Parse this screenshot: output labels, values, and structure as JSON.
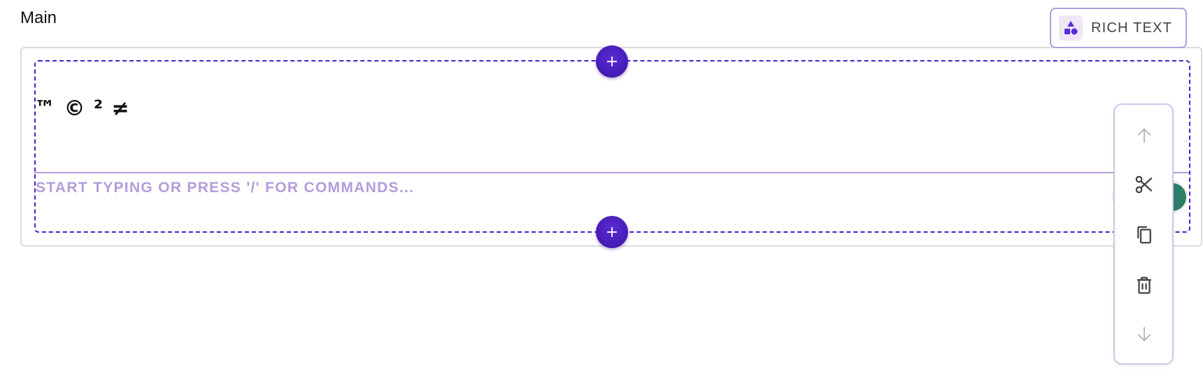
{
  "section": {
    "title": "Main"
  },
  "block_type": {
    "label": "RICH TEXT",
    "icon": "shapes-icon"
  },
  "editor": {
    "content": "™ © ² ≠",
    "placeholder": "START TYPING OR PRESS '/' FOR COMMANDS...",
    "add_above_label": "+",
    "add_below_label": "+"
  },
  "toolbar": {
    "items": [
      {
        "name": "move-up",
        "icon": "arrow-up-icon",
        "enabled": false
      },
      {
        "name": "cut",
        "icon": "scissors-icon",
        "enabled": true
      },
      {
        "name": "copy",
        "icon": "copy-icon",
        "enabled": true
      },
      {
        "name": "delete",
        "icon": "trash-icon",
        "enabled": true
      },
      {
        "name": "move-down",
        "icon": "arrow-down-icon",
        "enabled": false
      }
    ]
  },
  "colors": {
    "accent": "#4a1fc9",
    "accent_light": "#b39ddb",
    "border": "#dcdcdc",
    "icon_active": "#555555",
    "icon_disabled": "#b5b5b5"
  }
}
